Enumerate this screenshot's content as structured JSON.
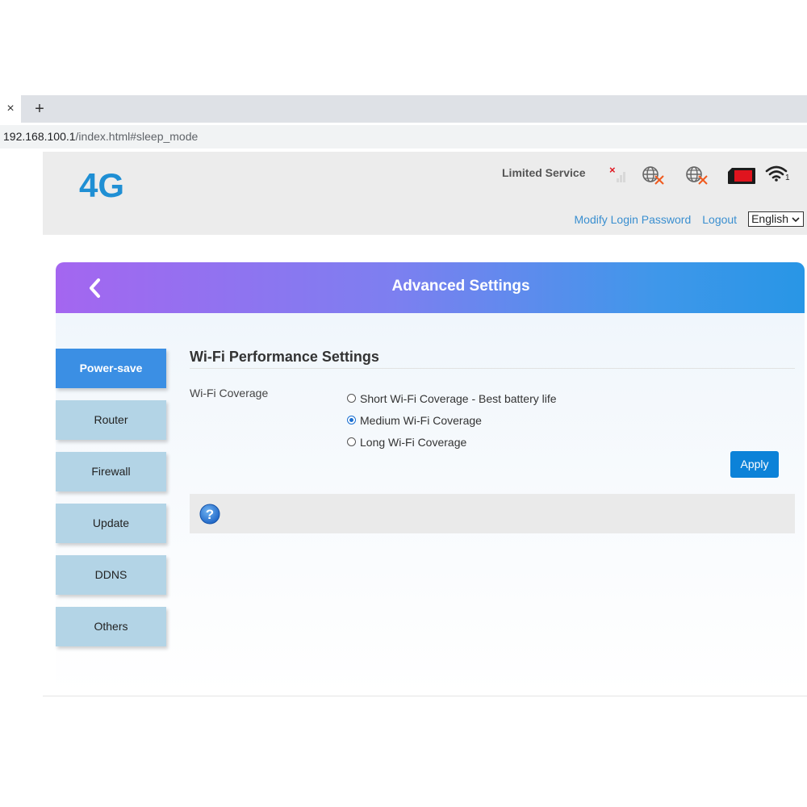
{
  "browser": {
    "tab_close": "×",
    "new_tab": "+",
    "url_host": "192.168.100.1",
    "url_path": "/index.html#sleep_mode"
  },
  "header": {
    "logo": "4G",
    "service_status": "Limited Service",
    "wifi_clients": "1",
    "links": {
      "modify_password": "Modify Login Password",
      "logout": "Logout"
    },
    "language": "English"
  },
  "panel": {
    "title": "Advanced Settings"
  },
  "sidebar": {
    "items": [
      {
        "label": "Power-save",
        "active": true
      },
      {
        "label": "Router"
      },
      {
        "label": "Firewall"
      },
      {
        "label": "Update"
      },
      {
        "label": "DDNS"
      },
      {
        "label": "Others"
      }
    ]
  },
  "content": {
    "section_title": "Wi-Fi Performance Settings",
    "coverage_label": "Wi-Fi Coverage",
    "options": [
      {
        "label": "Short Wi-Fi Coverage - Best battery life",
        "checked": false
      },
      {
        "label": "Medium Wi-Fi Coverage",
        "checked": true
      },
      {
        "label": "Long Wi-Fi Coverage",
        "checked": false
      }
    ],
    "apply_label": "Apply"
  },
  "colors": {
    "accent": "#0c82d8",
    "logo": "#1f8fd4",
    "sidebar_active": "#3b8fe4",
    "sidebar_item": "#b3d4e6",
    "sim_red": "#e0141e",
    "error_orange": "#f05a1e"
  },
  "icons": {
    "signal": "signal-no-service-icon",
    "internet1": "globe-disconnected-icon",
    "internet2": "globe-disconnected-icon",
    "sim": "sim-card-icon",
    "wifi": "wifi-icon",
    "back": "chevron-left-icon",
    "help": "question-mark-icon"
  }
}
